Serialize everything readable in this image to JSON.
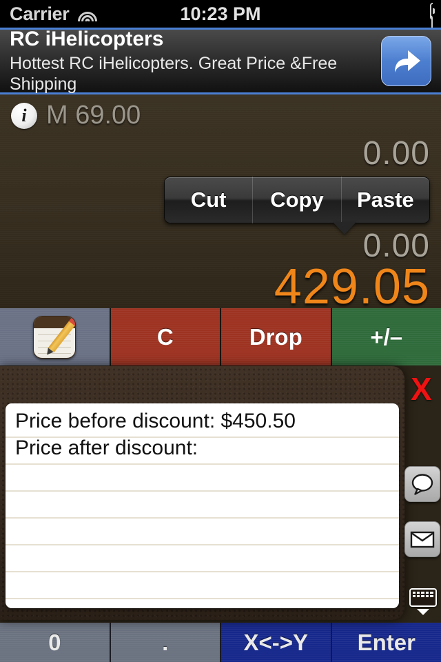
{
  "status_bar": {
    "carrier": "Carrier",
    "wifi_icon": "wifi-icon",
    "time": "10:23 PM",
    "battery_icon": "battery-icon"
  },
  "ad_banner": {
    "title": "RC iHelicopters",
    "subtitle": "Hottest RC iHelicopters. Great Price &Free Shipping",
    "action_icon": "share-arrow-icon",
    "border_color": "#4a7fd4"
  },
  "display": {
    "info_icon": "info-icon",
    "memory": "M 69.00",
    "register_t": "0.00",
    "register_z": "0.00",
    "register_y": "0.00",
    "register_x": "429.05",
    "accent_color": "#f0861a",
    "register_color": "#a9a49a"
  },
  "edit_menu": {
    "items": [
      {
        "label": "Cut"
      },
      {
        "label": "Copy"
      },
      {
        "label": "Paste"
      }
    ]
  },
  "function_row": {
    "buttons": [
      {
        "label": "",
        "icon": "notepad-icon",
        "color": "#6b7286"
      },
      {
        "label": "C",
        "icon": "",
        "color": "#9e3322"
      },
      {
        "label": "Drop",
        "icon": "",
        "color": "#9e3322"
      },
      {
        "label": "+/–",
        "icon": "",
        "color": "#2f6b3b"
      }
    ]
  },
  "note": {
    "close_label": "X",
    "close_color": "#ef1212",
    "lines": [
      "Price before discount: $450.50",
      "Price after discount:",
      "",
      "",
      "",
      "",
      "",
      ""
    ],
    "side_buttons": [
      {
        "icon": "speech-bubble-icon",
        "name": "sms-share-button"
      },
      {
        "icon": "envelope-icon",
        "name": "email-share-button"
      }
    ],
    "keyboard_dismiss_icon": "keyboard-dismiss-icon"
  },
  "keypad": {
    "bottom_row": [
      {
        "label": "0",
        "color": "#6b7280"
      },
      {
        "label": ".",
        "color": "#6b7280"
      },
      {
        "label": "X<->Y",
        "color": "#17288c"
      },
      {
        "label": "Enter",
        "color": "#17288c"
      }
    ]
  }
}
